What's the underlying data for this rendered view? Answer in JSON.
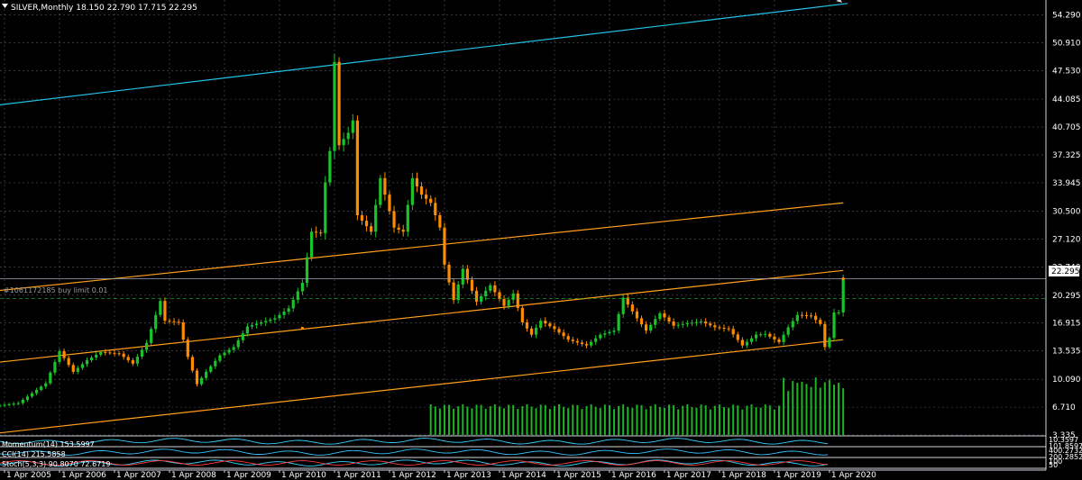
{
  "chart_data": {
    "type": "candlestick",
    "symbol_header": "SILVER,Monthly  18.150 22.790 17.715 22.295",
    "last_price_label": "22.295",
    "last_price": 22.295,
    "order_label": "#1061172185 buy limit 0.01",
    "order_price": 19.9,
    "ylim": [
      3.335,
      55.9
    ],
    "y_tick_labels": [
      "54.290",
      "50.910",
      "47.530",
      "44.085",
      "40.705",
      "37.325",
      "33.945",
      "30.500",
      "27.120",
      "23.740",
      "20.295",
      "16.915",
      "13.535",
      "10.090",
      "6.710",
      "3.335"
    ],
    "x_tick_labels": [
      "1 Apr 2005",
      "1 Apr 2006",
      "1 Apr 2007",
      "1 Apr 2008",
      "1 Apr 2009",
      "1 Apr 2010",
      "1 Apr 2011",
      "1 Apr 2012",
      "1 Apr 2013",
      "1 Apr 2014",
      "1 Apr 2015",
      "1 Apr 2016",
      "1 Apr 2017",
      "1 Apr 2018",
      "1 Apr 2019",
      "1 Apr 2020"
    ],
    "x_range": [
      "2005-04",
      "2020-05"
    ],
    "grid": true,
    "close_series": [
      {
        "date": "2005-01",
        "close": 6.8
      },
      {
        "date": "2005-07",
        "close": 7.2
      },
      {
        "date": "2006-01",
        "close": 9.6
      },
      {
        "date": "2006-04",
        "close": 13.5
      },
      {
        "date": "2006-07",
        "close": 11.0
      },
      {
        "date": "2006-10",
        "close": 12.4
      },
      {
        "date": "2007-01",
        "close": 13.4
      },
      {
        "date": "2007-05",
        "close": 13.2
      },
      {
        "date": "2007-08",
        "close": 12.0
      },
      {
        "date": "2007-11",
        "close": 14.5
      },
      {
        "date": "2008-02",
        "close": 19.6
      },
      {
        "date": "2008-03",
        "close": 17.2
      },
      {
        "date": "2008-06",
        "close": 17.0
      },
      {
        "date": "2008-08",
        "close": 12.8
      },
      {
        "date": "2008-10",
        "close": 9.5
      },
      {
        "date": "2008-12",
        "close": 11.0
      },
      {
        "date": "2009-03",
        "close": 13.0
      },
      {
        "date": "2009-06",
        "close": 14.0
      },
      {
        "date": "2009-09",
        "close": 16.5
      },
      {
        "date": "2009-12",
        "close": 17.0
      },
      {
        "date": "2010-03",
        "close": 17.5
      },
      {
        "date": "2010-06",
        "close": 18.7
      },
      {
        "date": "2010-09",
        "close": 21.8
      },
      {
        "date": "2010-11",
        "close": 28.0
      },
      {
        "date": "2011-01",
        "close": 27.8
      },
      {
        "date": "2011-02",
        "close": 34.0
      },
      {
        "date": "2011-03",
        "close": 37.8
      },
      {
        "date": "2011-04",
        "close": 48.6
      },
      {
        "date": "2011-05",
        "close": 38.5
      },
      {
        "date": "2011-07",
        "close": 40.0
      },
      {
        "date": "2011-08",
        "close": 41.5
      },
      {
        "date": "2011-09",
        "close": 30.0
      },
      {
        "date": "2011-12",
        "close": 28.0
      },
      {
        "date": "2012-02",
        "close": 34.5
      },
      {
        "date": "2012-05",
        "close": 28.5
      },
      {
        "date": "2012-07",
        "close": 28.0
      },
      {
        "date": "2012-09",
        "close": 34.5
      },
      {
        "date": "2012-11",
        "close": 32.5
      },
      {
        "date": "2013-01",
        "close": 31.5
      },
      {
        "date": "2013-03",
        "close": 28.5
      },
      {
        "date": "2013-04",
        "close": 24.0
      },
      {
        "date": "2013-06",
        "close": 19.7
      },
      {
        "date": "2013-08",
        "close": 23.5
      },
      {
        "date": "2013-11",
        "close": 19.5
      },
      {
        "date": "2014-02",
        "close": 21.5
      },
      {
        "date": "2014-05",
        "close": 19.0
      },
      {
        "date": "2014-07",
        "close": 20.5
      },
      {
        "date": "2014-09",
        "close": 17.0
      },
      {
        "date": "2014-11",
        "close": 15.5
      },
      {
        "date": "2015-01",
        "close": 17.2
      },
      {
        "date": "2015-04",
        "close": 16.2
      },
      {
        "date": "2015-07",
        "close": 14.9
      },
      {
        "date": "2015-11",
        "close": 14.2
      },
      {
        "date": "2016-02",
        "close": 15.5
      },
      {
        "date": "2016-05",
        "close": 16.0
      },
      {
        "date": "2016-07",
        "close": 20.0
      },
      {
        "date": "2016-10",
        "close": 17.5
      },
      {
        "date": "2016-12",
        "close": 16.0
      },
      {
        "date": "2017-03",
        "close": 18.1
      },
      {
        "date": "2017-06",
        "close": 16.6
      },
      {
        "date": "2017-09",
        "close": 16.9
      },
      {
        "date": "2017-12",
        "close": 17.1
      },
      {
        "date": "2018-03",
        "close": 16.4
      },
      {
        "date": "2018-06",
        "close": 16.2
      },
      {
        "date": "2018-09",
        "close": 14.2
      },
      {
        "date": "2018-12",
        "close": 15.5
      },
      {
        "date": "2019-02",
        "close": 15.6
      },
      {
        "date": "2019-05",
        "close": 14.6
      },
      {
        "date": "2019-07",
        "close": 16.4
      },
      {
        "date": "2019-09",
        "close": 17.9
      },
      {
        "date": "2019-12",
        "close": 17.8
      },
      {
        "date": "2020-02",
        "close": 16.8
      },
      {
        "date": "2020-03",
        "close": 14.0
      },
      {
        "date": "2020-04",
        "close": 15.1
      },
      {
        "date": "2020-05",
        "close": 18.2
      },
      {
        "date": "2020-06",
        "close": 18.2
      },
      {
        "date": "2020-07",
        "close": 22.295
      }
    ],
    "trendlines": [
      {
        "color": "#22c3e6",
        "start": {
          "date": "2004-12",
          "price": 43.2
        },
        "end": {
          "date": "2020-08",
          "price": 55.7
        }
      },
      {
        "color": "#ff9f1a",
        "start": {
          "date": "2004-12",
          "price": 20.7
        },
        "end": {
          "date": "2020-07",
          "price": 31.5
        }
      },
      {
        "color": "#ff9f1a",
        "start": {
          "date": "2004-12",
          "price": 12.0
        },
        "end": {
          "date": "2020-07",
          "price": 23.3
        }
      },
      {
        "color": "#ff9f1a",
        "start": {
          "date": "2004-12",
          "price": 3.4
        },
        "end": {
          "date": "2020-07",
          "price": 14.9
        }
      }
    ],
    "indicators": [
      {
        "label": "Momentum(14) 153.5997",
        "values": [
          "10.3597",
          "101.8597"
        ]
      },
      {
        "label": "CCI(14) 215.5858",
        "values": [
          "400.2732",
          "200.2852"
        ]
      },
      {
        "label": "Stoch(5,3,3) 90.8070 72.6719",
        "values": [
          "100",
          "50"
        ]
      }
    ],
    "colors": {
      "bull": "#19c42b",
      "bear": "#ff8c00",
      "grid": "#6e7a8c",
      "background": "#000000",
      "text": "#ffffff",
      "volume": "#1bb524",
      "momentum": "#3ad0ff",
      "cci": "#39c2ff",
      "stoch_main": "#3ad0ff",
      "stoch_signal": "#ff3b3b",
      "price_line": "#9aa2b2"
    }
  }
}
